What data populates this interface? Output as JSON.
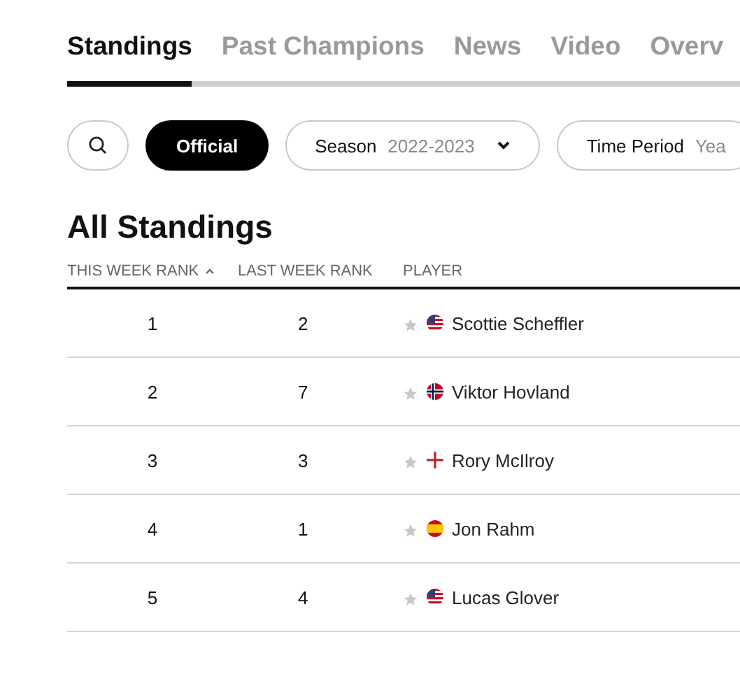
{
  "tabs": [
    {
      "label": "Standings",
      "selected": true
    },
    {
      "label": "Past Champions",
      "selected": false
    },
    {
      "label": "News",
      "selected": false
    },
    {
      "label": "Video",
      "selected": false
    },
    {
      "label": "Overv",
      "selected": false
    }
  ],
  "filters": {
    "official": {
      "label": "Official",
      "selected": true
    },
    "season": {
      "label": "Season",
      "value": "2022-2023"
    },
    "time_period": {
      "label": "Time Period",
      "value": "Yea"
    }
  },
  "title": "All Standings",
  "table": {
    "columns": [
      {
        "label": "THIS WEEK RANK",
        "sorted": true
      },
      {
        "label": "LAST WEEK RANK",
        "sorted": false
      },
      {
        "label": "PLAYER",
        "sorted": false
      }
    ],
    "rows": [
      {
        "this_week": "1",
        "last_week": "2",
        "kind": "us",
        "player": "Scottie Scheffler"
      },
      {
        "this_week": "2",
        "last_week": "7",
        "kind": "no",
        "player": "Viktor Hovland"
      },
      {
        "this_week": "3",
        "last_week": "3",
        "kind": "ni",
        "player": "Rory McIlroy"
      },
      {
        "this_week": "4",
        "last_week": "1",
        "kind": "es",
        "player": "Jon Rahm"
      },
      {
        "this_week": "5",
        "last_week": "4",
        "kind": "us",
        "player": "Lucas Glover"
      }
    ]
  }
}
